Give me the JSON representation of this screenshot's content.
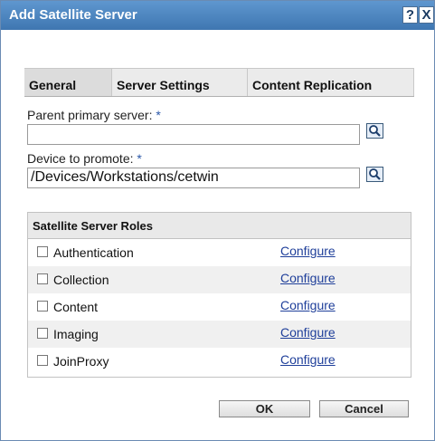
{
  "window": {
    "title": "Add Satellite Server",
    "help_label": "?",
    "close_label": "X"
  },
  "tabs": [
    {
      "label": "General",
      "active": true
    },
    {
      "label": "Server Settings",
      "active": false
    },
    {
      "label": "Content Replication",
      "active": false
    }
  ],
  "form": {
    "parent_label": "Parent primary server:",
    "parent_value": "",
    "device_label": "Device to promote:",
    "device_value": "/Devices/Workstations/cetwin",
    "required_mark": "*"
  },
  "roles": {
    "header": "Satellite Server Roles",
    "configure_label": "Configure",
    "items": [
      {
        "label": "Authentication",
        "checked": false
      },
      {
        "label": "Collection",
        "checked": false
      },
      {
        "label": "Content",
        "checked": false
      },
      {
        "label": "Imaging",
        "checked": false
      },
      {
        "label": "JoinProxy",
        "checked": false
      }
    ]
  },
  "buttons": {
    "ok": "OK",
    "cancel": "Cancel"
  },
  "icons": {
    "search": "search-icon"
  },
  "colors": {
    "titlebar": "#3f76b1",
    "link": "#1f3f9a",
    "required": "#2a57a8"
  }
}
